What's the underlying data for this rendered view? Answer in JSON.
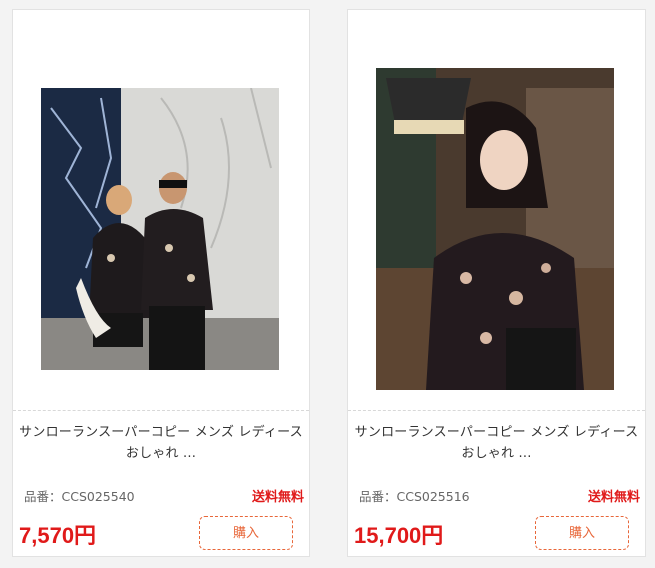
{
  "products": [
    {
      "title_line1": "サンローランスーパーコピー メンズ レディース",
      "title_line2": "おしゃれ ...",
      "code": "品番：CCS025540",
      "shipping": "送料無料",
      "price": "7,570円",
      "buy_label": "購入"
    },
    {
      "title_line1": "サンローランスーパーコピー メンズ レディース",
      "title_line2": "おしゃれ ...",
      "code": "品番：CCS025516",
      "shipping": "送料無料",
      "price": "15,700円",
      "buy_label": "購入"
    }
  ],
  "colors": {
    "accent_red": "#e01a1a",
    "buy_border": "#e8673a"
  }
}
